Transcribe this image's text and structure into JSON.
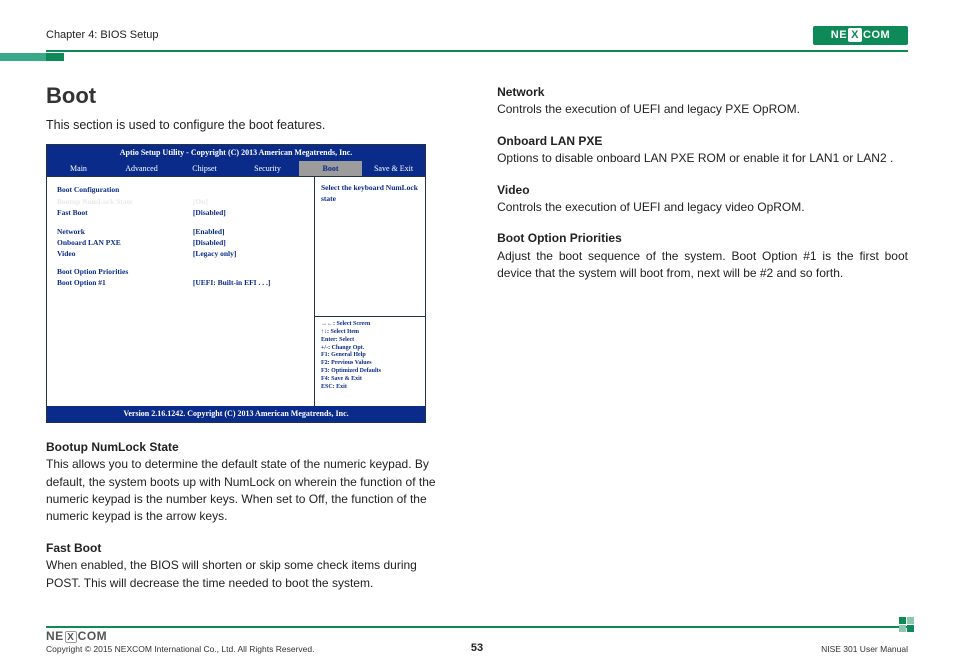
{
  "header": {
    "chapter": "Chapter 4: BIOS Setup",
    "logo_text": "NE COM",
    "logo_x": "X"
  },
  "left": {
    "title": "Boot",
    "intro": "This section is used to configure the boot features.",
    "numlock_h": "Bootup NumLock State",
    "numlock_p": "This allows you to determine the default state of the numeric keypad. By default, the system boots up with NumLock on wherein the function of the numeric keypad is the number keys. When set to Off, the function of the numeric keypad is the arrow keys.",
    "fastboot_h": "Fast Boot",
    "fastboot_p": "When enabled, the BIOS will shorten or skip some check items during POST. This will decrease the time needed to boot the system."
  },
  "right": {
    "network_h": "Network",
    "network_p": "Controls the execution of UEFI and legacy PXE OpROM.",
    "lanpxe_h": "Onboard LAN PXE",
    "lanpxe_p": "Options to disable onboard LAN PXE ROM or enable it for LAN1 or LAN2 .",
    "video_h": "Video",
    "video_p": "Controls the execution of UEFI and legacy video OpROM.",
    "bop_h": "Boot Option Priorities",
    "bop_p": "Adjust the boot sequence of the system. Boot Option #1 is the first boot device that the system will boot from, next will be #2 and so forth."
  },
  "bios": {
    "title": "Aptio Setup Utility - Copyright (C) 2013 American Megatrends, Inc.",
    "tabs": {
      "main": "Main",
      "advanced": "Advanced",
      "chipset": "Chipset",
      "security": "Security",
      "boot": "Boot",
      "save": "Save & Exit"
    },
    "section1": "Boot Configuration",
    "row_numlock_l": "Bootup NumLock State",
    "row_numlock_v": "[On]",
    "row_fastboot_l": "Fast Boot",
    "row_fastboot_v": "[Disabled]",
    "row_network_l": "Network",
    "row_network_v": "[Enabled]",
    "row_lanpxe_l": "Onboard LAN PXE",
    "row_lanpxe_v": "[Disabled]",
    "row_video_l": "Video",
    "row_video_v": "[Legacy only]",
    "section2": "Boot Option Priorities",
    "row_bo1_l": "Boot Option #1",
    "row_bo1_v": "[UEFI: Built-in EFI . . .]",
    "help": "Select the keyboard NumLock state",
    "keys": {
      "k1": "→←: Select Screen",
      "k2": "↑↓: Select Item",
      "k3": "Enter: Select",
      "k4": "+/-: Change Opt.",
      "k5": "F1: General Help",
      "k6": "F2: Previous Values",
      "k7": "F3: Optimized Defaults",
      "k8": "F4: Save & Exit",
      "k9": "ESC: Exit"
    },
    "footer": "Version 2.16.1242. Copyright (C) 2013 American Megatrends, Inc."
  },
  "footer": {
    "copyright": "Copyright © 2015 NEXCOM International Co., Ltd. All Rights Reserved.",
    "page": "53",
    "manual": "NISE 301 User Manual",
    "logo_text": "NE COM",
    "logo_x": "X"
  }
}
